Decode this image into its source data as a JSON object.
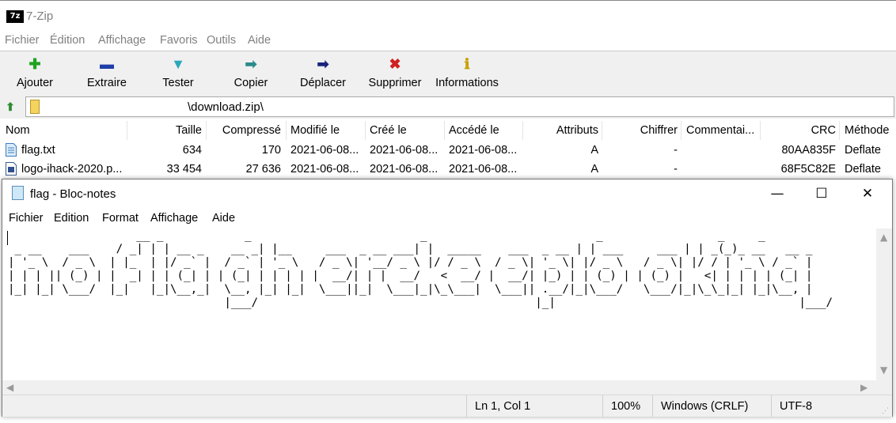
{
  "zip": {
    "title": "7-Zip",
    "logo_text": "7z",
    "menu": [
      "Fichier",
      "Édition",
      "Affichage",
      "Favoris",
      "Outils",
      "Aide"
    ],
    "toolbar": [
      {
        "label": "Ajouter",
        "icon": "add-icon",
        "glyph": "✚",
        "color": "#1fa31f"
      },
      {
        "label": "Extraire",
        "icon": "extract-icon",
        "glyph": "▬",
        "color": "#1f3ea8"
      },
      {
        "label": "Tester",
        "icon": "test-icon",
        "glyph": "▼",
        "color": "#2aa8b8"
      },
      {
        "label": "Copier",
        "icon": "copy-icon",
        "glyph": "➡",
        "color": "#2a8c8c"
      },
      {
        "label": "Déplacer",
        "icon": "move-icon",
        "glyph": "➡",
        "color": "#1a237e"
      },
      {
        "label": "Supprimer",
        "icon": "delete-icon",
        "glyph": "✖",
        "color": "#d02020"
      },
      {
        "label": "Informations",
        "icon": "info-icon",
        "glyph": "ℹ",
        "color": "#c8a000"
      }
    ],
    "address": "\\download.zip\\",
    "columns": [
      "Nom",
      "Taille",
      "Compressé",
      "Modifié le",
      "Créé le",
      "Accédé le",
      "Attributs",
      "Chiffrer",
      "Commentai...",
      "CRC",
      "Méthode"
    ],
    "rows": [
      [
        "flag.txt",
        "634",
        "170",
        "2021-06-08...",
        "2021-06-08...",
        "2021-06-08...",
        "A",
        "-",
        "",
        "80AA835F",
        "Deflate"
      ],
      [
        "logo-ihack-2020.p...",
        "33 454",
        "27 636",
        "2021-06-08...",
        "2021-06-08...",
        "2021-06-08...",
        "A",
        "-",
        "",
        "68F5C82E",
        "Deflate"
      ]
    ]
  },
  "notepad": {
    "title": "flag - Bloc-notes",
    "menu": [
      "Fichier",
      "Edition",
      "Format",
      "Affichage",
      "Aide"
    ],
    "content": "                   __ _            _                         _                         _                 _     _\n _ __    ___    / _| | | __ _    __ _| |__     ___  _ __ ___| |  _____    ___  _ __ | | ___     ___ | | _(_)_ __   __ _\n| '_ \\  / _ \\  | |_  | |/ _` |  / _` | '_ \\   / _ \\| '__/ _ \\ |/ / _ \\  / _ \\| '_ \\| |/ _ \\   / _ \\| |/ / | '_ \\ / _` |\n| | | || (_) | |  _| | | (_| | | (_| | | | | |  __/| | |  __/   <  __/ |  __/| |_) | | (_) | | (_) |   <| | | | | (_| |\n|_| |_| \\___/  |_|   |_|\\__,_|  \\__, |_| |_|  \\___||_|  \\___|_|\\_\\___|  \\___|| .__/|_|\\___/   \\___/|_|\\_\\_|_| |_|\\__, |\n                                |___/                                         |_|                                    |___/",
    "status": {
      "position": "Ln 1, Col 1",
      "zoom": "100%",
      "line_ending": "Windows (CRLF)",
      "encoding": "UTF-8"
    },
    "controls": {
      "minimize": "—",
      "maximize": "☐",
      "close": "✕"
    }
  }
}
